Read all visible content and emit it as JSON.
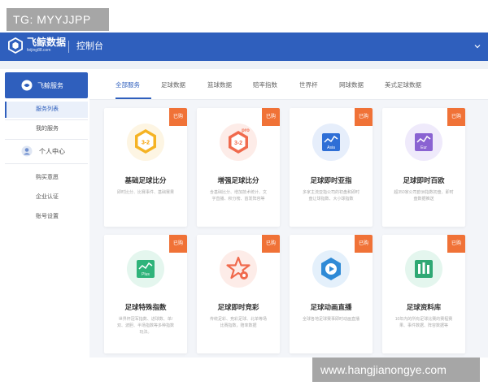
{
  "watermarks": {
    "top": "TG: MYYJJPP",
    "bottom": "www.hangjianongye.com"
  },
  "header": {
    "logo_title": "飞鲸数据",
    "logo_sub": "feijing88.com",
    "page_title": "控制台",
    "accent": "#2f5fbd"
  },
  "sidebar": {
    "section": "飞鲸服务",
    "items": [
      "服务列表",
      "我的服务"
    ],
    "group": "个人中心",
    "group_items": [
      "购买意愿",
      "企业认证",
      "账号设置"
    ]
  },
  "tabs": [
    "全部服务",
    "足球数据",
    "篮球数据",
    "赔率指数",
    "世界杯",
    "网球数据",
    "美式足球数据"
  ],
  "cards": [
    {
      "title": "基础足球比分",
      "badge": "已购",
      "icon": "score-3-2-icon",
      "icon_text": "3-2",
      "desc": "即时比分、比赛事件、基础赛果"
    },
    {
      "title": "增强足球比分",
      "badge": "已购",
      "icon": "score-pro-icon",
      "icon_text": "3-2",
      "icon_sub": "pro",
      "desc": "含基础比分、增加技术统计、文字直播、积分榜、首发阵容等"
    },
    {
      "title": "足球即时亚指",
      "badge": "已购",
      "icon": "asia-index-icon",
      "icon_text": "Asia",
      "desc": "多家主流亚指公司的初盘和即时盘让球指数、大小球指数"
    },
    {
      "title": "足球即时百欧",
      "badge": "已购",
      "icon": "euro-index-icon",
      "icon_text": "Eur",
      "desc": "超350家公司欧洲指数初盘、即时盘数据推送"
    },
    {
      "title": "足球特殊指数",
      "badge": "已购",
      "icon": "plus-index-icon",
      "icon_text": "Plus",
      "desc": "世界杯冠军指数、进球数、单/双、波胆、半场指数等多种指数玩法。"
    },
    {
      "title": "足球即时竞彩",
      "badge": "已购",
      "icon": "lottery-star-icon",
      "icon_text": "",
      "desc": "传统足彩、竞彩足球、北单等场比赛指数，赔率数据"
    },
    {
      "title": "足球动画直播",
      "badge": "已购",
      "icon": "animation-play-icon",
      "icon_text": "",
      "desc": "全球各地足球赛事即时动画直播"
    },
    {
      "title": "足球资料库",
      "badge": "已购",
      "icon": "database-icon",
      "icon_text": "",
      "desc": "10年内的所有足球比赛的赛程赛果、事件数据、阵容数据等"
    }
  ]
}
